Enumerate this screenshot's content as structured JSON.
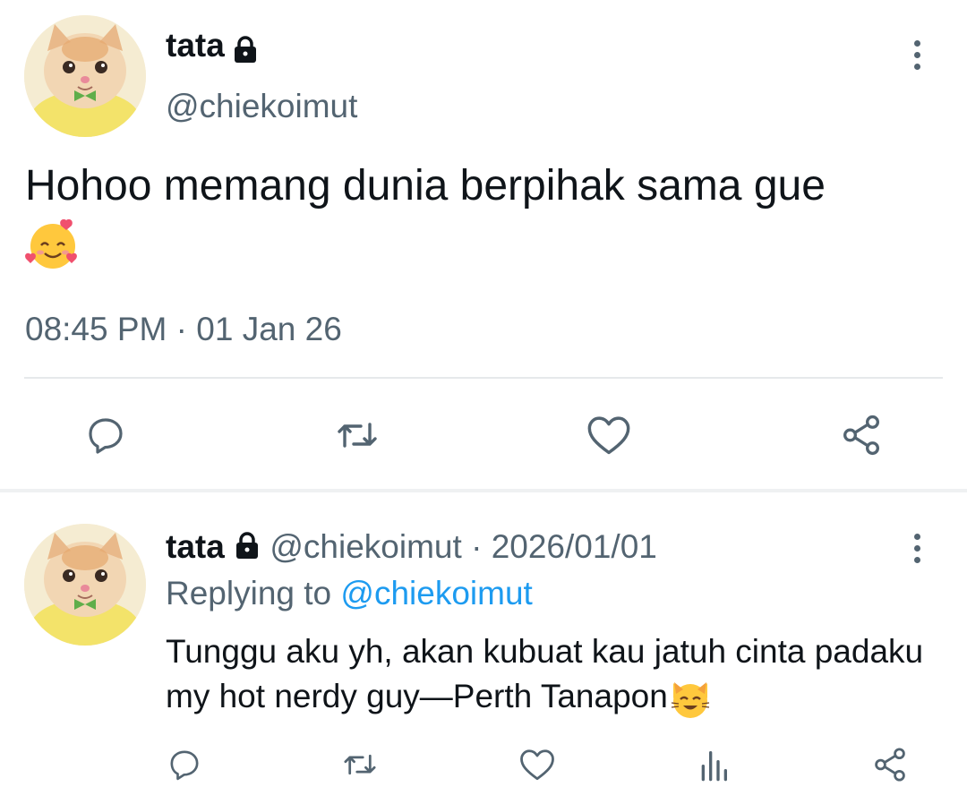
{
  "tweet": {
    "display_name": "tata",
    "handle": "@chiekoimut",
    "text": "Hohoo memang dunia berpihak sama gue",
    "emoji": "smiling-face-with-hearts",
    "time": "08:45 PM",
    "separator": "·",
    "date": "01 Jan 26"
  },
  "reply": {
    "display_name": "tata",
    "handle": "@chiekoimut",
    "separator": "·",
    "date": "2026/01/01",
    "replying_to_label": "Replying to",
    "replying_to_handle": "@chiekoimut",
    "text": "Tunggu aku yh, akan kubuat kau jatuh cinta padaku my hot nerdy guy—Perth Tanapon",
    "emoji": "smiling-cat-face"
  },
  "colors": {
    "text": "#0f1419",
    "secondary": "#536471",
    "link": "#1d9bf0",
    "divider": "#e6e9eb"
  },
  "icons": {
    "actions": [
      "reply-icon",
      "retweet-icon",
      "like-icon",
      "share-icon"
    ],
    "reply_actions": [
      "reply-icon",
      "retweet-icon",
      "like-icon",
      "analytics-icon",
      "share-icon"
    ]
  }
}
